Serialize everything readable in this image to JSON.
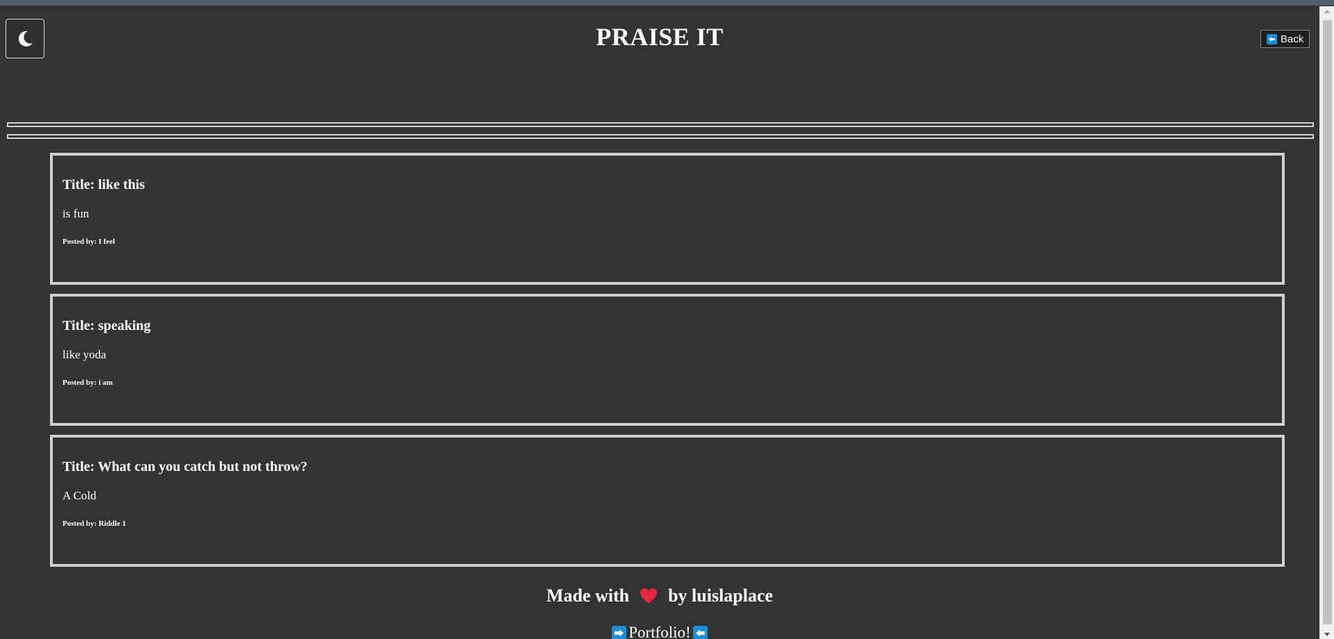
{
  "header": {
    "title": "PRAISE IT",
    "theme_toggle_icon": "moon-icon",
    "back_label": "Back",
    "back_icon": "left-arrow-icon"
  },
  "posts": [
    {
      "title": "Title: like this",
      "body": "is fun",
      "author": "Posted by: I feel"
    },
    {
      "title": "Title: speaking",
      "body": "like yoda",
      "author": "Posted by: i am"
    },
    {
      "title": "Title: What can you catch but not throw?",
      "body": "A Cold",
      "author": "Posted by: Riddle 1"
    }
  ],
  "footer": {
    "made_with": "Made with",
    "by": "by luislaplace",
    "heart_icon": "heart-icon",
    "portfolio_label": "Portfolio!",
    "portfolio_left_icon": "right-arrow-icon",
    "portfolio_right_icon": "left-arrow-icon"
  },
  "colors": {
    "background": "#333333",
    "text": "#ffffff",
    "card_border": "#cfcfcf",
    "accent_arrow": "#1b8fd6",
    "heart": "#e8283c"
  }
}
